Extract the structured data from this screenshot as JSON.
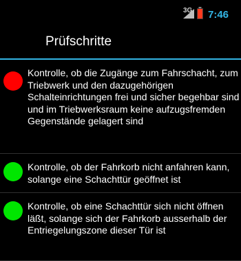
{
  "statusbar": {
    "network": "3G",
    "clock": "7:46",
    "icons": {
      "signal": "signal-icon",
      "battery": "battery-low-icon"
    },
    "colors": {
      "clock": "#33b5e5",
      "battery": "#ff3b1f"
    }
  },
  "actionbar": {
    "title": "Prüfschritte",
    "accent": "#33b5e5"
  },
  "steps": [
    {
      "status": "red",
      "color": "#ff0000",
      "text": "Kontrolle, ob die Zugänge zum Fahrschacht, zum Triebwerk und den dazugehörigen Schalteinrichtungen frei und sicher begehbar sind und im Triebwerksraum keine aufzugsfremden Gegenstände gelagert sind"
    },
    {
      "status": "green",
      "color": "#00e600",
      "text": "Kontrolle, ob der Fahrkorb nicht anfahren kann, solange eine Schachttür geöffnet ist"
    },
    {
      "status": "green",
      "color": "#00e600",
      "text": "Kontrolle, ob eine Schachttür sich nicht öffnen läßt, solange sich der Fahrkorb ausserhalb der Entriegelungszone dieser Tür ist"
    }
  ]
}
